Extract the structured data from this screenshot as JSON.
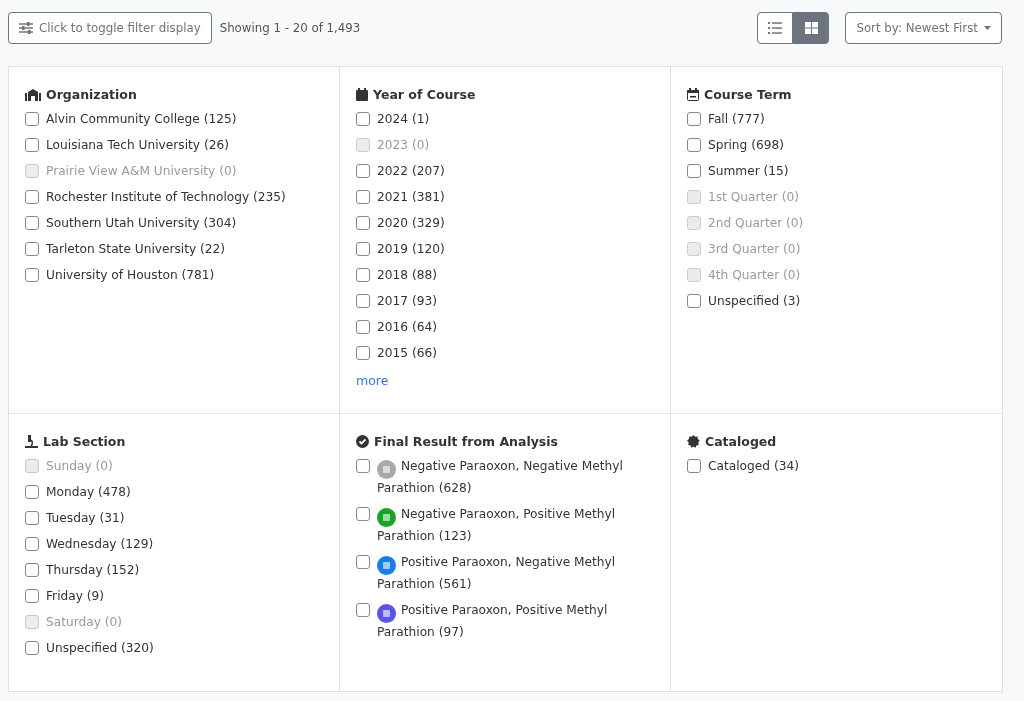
{
  "toolbar": {
    "filter_button": "Click to toggle filter display",
    "showing": "Showing 1 - 20 of 1,493",
    "views": [
      {
        "kind": "list",
        "selected": false
      },
      {
        "kind": "grid",
        "selected": true
      }
    ],
    "sort": "Sort by: Newest First"
  },
  "facets": [
    {
      "title": "Organization",
      "items": [
        {
          "label": "Alvin Community College (125)",
          "checked": false,
          "disabled": false
        },
        {
          "label": "Louisiana Tech University (26)",
          "checked": false,
          "disabled": false
        },
        {
          "label": "Prairie View A&M University (0)",
          "checked": false,
          "disabled": true
        },
        {
          "label": "Rochester Institute of Technology (235)",
          "checked": false,
          "disabled": false
        },
        {
          "label": "Southern Utah University (304)",
          "checked": false,
          "disabled": false
        },
        {
          "label": "Tarleton State University (22)",
          "checked": false,
          "disabled": false
        },
        {
          "label": "University of Houston (781)",
          "checked": false,
          "disabled": false
        }
      ]
    },
    {
      "title": "Year of Course",
      "items": [
        {
          "label": "2024 (1)",
          "checked": false,
          "disabled": false
        },
        {
          "label": "2023 (0)",
          "checked": false,
          "disabled": true
        },
        {
          "label": "2022 (207)",
          "checked": false,
          "disabled": false
        },
        {
          "label": "2021 (381)",
          "checked": false,
          "disabled": false
        },
        {
          "label": "2020 (329)",
          "checked": false,
          "disabled": false
        },
        {
          "label": "2019 (120)",
          "checked": false,
          "disabled": false
        },
        {
          "label": "2018 (88)",
          "checked": false,
          "disabled": false
        },
        {
          "label": "2017 (93)",
          "checked": false,
          "disabled": false
        },
        {
          "label": "2016 (64)",
          "checked": false,
          "disabled": false
        },
        {
          "label": "2015 (66)",
          "checked": false,
          "disabled": false
        }
      ],
      "more": "more"
    },
    {
      "title": "Course Term",
      "items": [
        {
          "label": "Fall (777)",
          "checked": false,
          "disabled": false
        },
        {
          "label": "Spring (698)",
          "checked": false,
          "disabled": false
        },
        {
          "label": "Summer (15)",
          "checked": false,
          "disabled": false
        },
        {
          "label": "1st Quarter (0)",
          "checked": false,
          "disabled": true
        },
        {
          "label": "2nd Quarter (0)",
          "checked": false,
          "disabled": true
        },
        {
          "label": "3rd Quarter (0)",
          "checked": false,
          "disabled": true
        },
        {
          "label": "4th Quarter (0)",
          "checked": false,
          "disabled": true
        },
        {
          "label": "Unspecified (3)",
          "checked": false,
          "disabled": false
        }
      ]
    },
    {
      "title": "Lab Section",
      "items": [
        {
          "label": "Sunday (0)",
          "checked": false,
          "disabled": true
        },
        {
          "label": "Monday (478)",
          "checked": false,
          "disabled": false
        },
        {
          "label": "Tuesday (31)",
          "checked": false,
          "disabled": false
        },
        {
          "label": "Wednesday (129)",
          "checked": false,
          "disabled": false
        },
        {
          "label": "Thursday (152)",
          "checked": false,
          "disabled": false
        },
        {
          "label": "Friday (9)",
          "checked": false,
          "disabled": false
        },
        {
          "label": "Saturday (0)",
          "checked": false,
          "disabled": true
        },
        {
          "label": "Unspecified (320)",
          "checked": false,
          "disabled": false
        }
      ]
    },
    {
      "title": "Final Result from Analysis",
      "items": [
        {
          "label": "Negative Paraoxon, Negative Methyl Parathion (628)",
          "checked": false,
          "disabled": false,
          "color": "#a9a9a9"
        },
        {
          "label": "Negative Paraoxon, Positive Methyl Parathion (123)",
          "checked": false,
          "disabled": false,
          "color": "#1aa326"
        },
        {
          "label": "Positive Paraoxon, Negative Methyl Parathion (561)",
          "checked": false,
          "disabled": false,
          "color": "#1a7ce8"
        },
        {
          "label": "Positive Paraoxon, Positive Methyl Parathion (97)",
          "checked": false,
          "disabled": false,
          "color": "#5a55e6"
        }
      ]
    },
    {
      "title": "Cataloged",
      "items": [
        {
          "label": "Cataloged (34)",
          "checked": false,
          "disabled": false
        }
      ]
    }
  ]
}
